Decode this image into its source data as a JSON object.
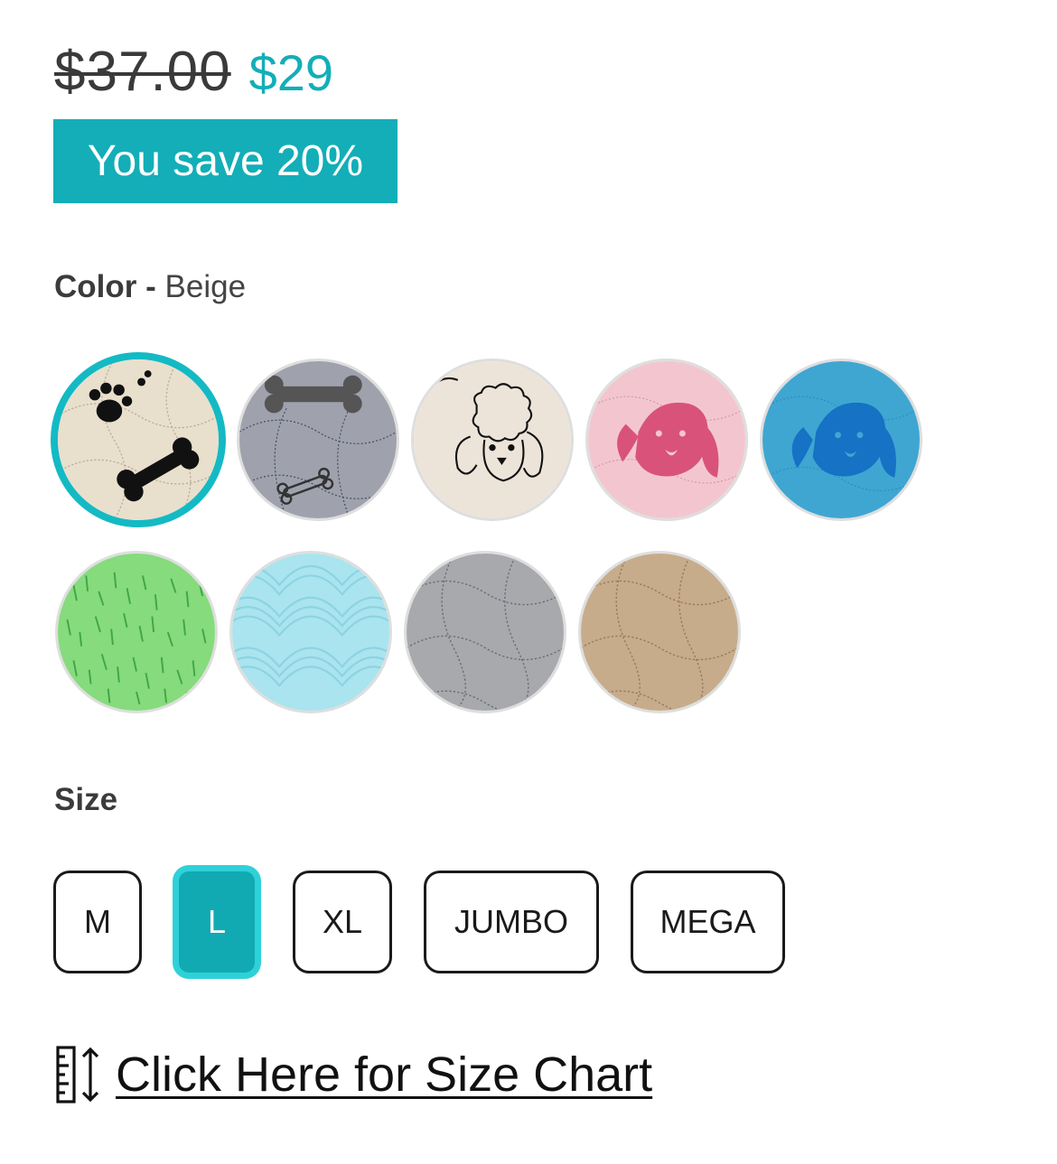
{
  "price": {
    "original": "$37.00",
    "sale": "$29",
    "badge": "You save 20%"
  },
  "color": {
    "label": "Color",
    "separator": "-",
    "selected": "Beige",
    "swatches": [
      {
        "pattern": "beige-paws-bones",
        "selected": true
      },
      {
        "pattern": "gray-bones"
      },
      {
        "pattern": "cream-poodle"
      },
      {
        "pattern": "pink-dog"
      },
      {
        "pattern": "blue-dog"
      },
      {
        "pattern": "green-grass"
      },
      {
        "pattern": "light-blue-waves"
      },
      {
        "pattern": "gray-quilted"
      },
      {
        "pattern": "tan-quilted"
      }
    ]
  },
  "size": {
    "label": "Size",
    "options": [
      "M",
      "L",
      "XL",
      "JUMBO",
      "MEGA"
    ],
    "selected": "L"
  },
  "size_chart": {
    "icon": "ruler-height-icon",
    "link_text": "Click Here for Size Chart"
  },
  "colors": {
    "accent": "#13aeb8",
    "selected_ring": "#13bac4"
  }
}
